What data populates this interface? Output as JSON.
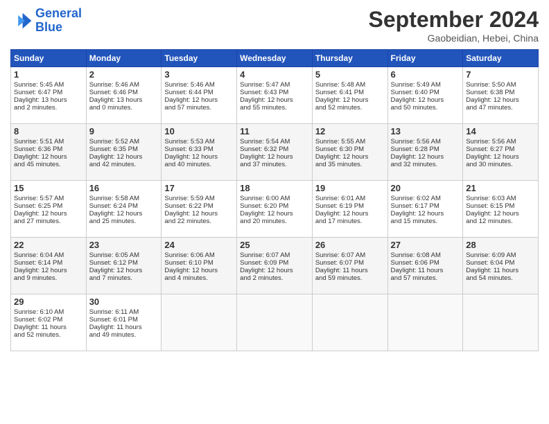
{
  "logo": {
    "line1": "General",
    "line2": "Blue"
  },
  "header": {
    "month": "September 2024",
    "location": "Gaobeidian, Hebei, China"
  },
  "weekdays": [
    "Sunday",
    "Monday",
    "Tuesday",
    "Wednesday",
    "Thursday",
    "Friday",
    "Saturday"
  ],
  "weeks": [
    [
      {
        "day": "1",
        "lines": [
          "Sunrise: 5:45 AM",
          "Sunset: 6:47 PM",
          "Daylight: 13 hours",
          "and 2 minutes."
        ]
      },
      {
        "day": "2",
        "lines": [
          "Sunrise: 5:46 AM",
          "Sunset: 6:46 PM",
          "Daylight: 13 hours",
          "and 0 minutes."
        ]
      },
      {
        "day": "3",
        "lines": [
          "Sunrise: 5:46 AM",
          "Sunset: 6:44 PM",
          "Daylight: 12 hours",
          "and 57 minutes."
        ]
      },
      {
        "day": "4",
        "lines": [
          "Sunrise: 5:47 AM",
          "Sunset: 6:43 PM",
          "Daylight: 12 hours",
          "and 55 minutes."
        ]
      },
      {
        "day": "5",
        "lines": [
          "Sunrise: 5:48 AM",
          "Sunset: 6:41 PM",
          "Daylight: 12 hours",
          "and 52 minutes."
        ]
      },
      {
        "day": "6",
        "lines": [
          "Sunrise: 5:49 AM",
          "Sunset: 6:40 PM",
          "Daylight: 12 hours",
          "and 50 minutes."
        ]
      },
      {
        "day": "7",
        "lines": [
          "Sunrise: 5:50 AM",
          "Sunset: 6:38 PM",
          "Daylight: 12 hours",
          "and 47 minutes."
        ]
      }
    ],
    [
      {
        "day": "8",
        "lines": [
          "Sunrise: 5:51 AM",
          "Sunset: 6:36 PM",
          "Daylight: 12 hours",
          "and 45 minutes."
        ]
      },
      {
        "day": "9",
        "lines": [
          "Sunrise: 5:52 AM",
          "Sunset: 6:35 PM",
          "Daylight: 12 hours",
          "and 42 minutes."
        ]
      },
      {
        "day": "10",
        "lines": [
          "Sunrise: 5:53 AM",
          "Sunset: 6:33 PM",
          "Daylight: 12 hours",
          "and 40 minutes."
        ]
      },
      {
        "day": "11",
        "lines": [
          "Sunrise: 5:54 AM",
          "Sunset: 6:32 PM",
          "Daylight: 12 hours",
          "and 37 minutes."
        ]
      },
      {
        "day": "12",
        "lines": [
          "Sunrise: 5:55 AM",
          "Sunset: 6:30 PM",
          "Daylight: 12 hours",
          "and 35 minutes."
        ]
      },
      {
        "day": "13",
        "lines": [
          "Sunrise: 5:56 AM",
          "Sunset: 6:28 PM",
          "Daylight: 12 hours",
          "and 32 minutes."
        ]
      },
      {
        "day": "14",
        "lines": [
          "Sunrise: 5:56 AM",
          "Sunset: 6:27 PM",
          "Daylight: 12 hours",
          "and 30 minutes."
        ]
      }
    ],
    [
      {
        "day": "15",
        "lines": [
          "Sunrise: 5:57 AM",
          "Sunset: 6:25 PM",
          "Daylight: 12 hours",
          "and 27 minutes."
        ]
      },
      {
        "day": "16",
        "lines": [
          "Sunrise: 5:58 AM",
          "Sunset: 6:24 PM",
          "Daylight: 12 hours",
          "and 25 minutes."
        ]
      },
      {
        "day": "17",
        "lines": [
          "Sunrise: 5:59 AM",
          "Sunset: 6:22 PM",
          "Daylight: 12 hours",
          "and 22 minutes."
        ]
      },
      {
        "day": "18",
        "lines": [
          "Sunrise: 6:00 AM",
          "Sunset: 6:20 PM",
          "Daylight: 12 hours",
          "and 20 minutes."
        ]
      },
      {
        "day": "19",
        "lines": [
          "Sunrise: 6:01 AM",
          "Sunset: 6:19 PM",
          "Daylight: 12 hours",
          "and 17 minutes."
        ]
      },
      {
        "day": "20",
        "lines": [
          "Sunrise: 6:02 AM",
          "Sunset: 6:17 PM",
          "Daylight: 12 hours",
          "and 15 minutes."
        ]
      },
      {
        "day": "21",
        "lines": [
          "Sunrise: 6:03 AM",
          "Sunset: 6:15 PM",
          "Daylight: 12 hours",
          "and 12 minutes."
        ]
      }
    ],
    [
      {
        "day": "22",
        "lines": [
          "Sunrise: 6:04 AM",
          "Sunset: 6:14 PM",
          "Daylight: 12 hours",
          "and 9 minutes."
        ]
      },
      {
        "day": "23",
        "lines": [
          "Sunrise: 6:05 AM",
          "Sunset: 6:12 PM",
          "Daylight: 12 hours",
          "and 7 minutes."
        ]
      },
      {
        "day": "24",
        "lines": [
          "Sunrise: 6:06 AM",
          "Sunset: 6:10 PM",
          "Daylight: 12 hours",
          "and 4 minutes."
        ]
      },
      {
        "day": "25",
        "lines": [
          "Sunrise: 6:07 AM",
          "Sunset: 6:09 PM",
          "Daylight: 12 hours",
          "and 2 minutes."
        ]
      },
      {
        "day": "26",
        "lines": [
          "Sunrise: 6:07 AM",
          "Sunset: 6:07 PM",
          "Daylight: 11 hours",
          "and 59 minutes."
        ]
      },
      {
        "day": "27",
        "lines": [
          "Sunrise: 6:08 AM",
          "Sunset: 6:06 PM",
          "Daylight: 11 hours",
          "and 57 minutes."
        ]
      },
      {
        "day": "28",
        "lines": [
          "Sunrise: 6:09 AM",
          "Sunset: 6:04 PM",
          "Daylight: 11 hours",
          "and 54 minutes."
        ]
      }
    ],
    [
      {
        "day": "29",
        "lines": [
          "Sunrise: 6:10 AM",
          "Sunset: 6:02 PM",
          "Daylight: 11 hours",
          "and 52 minutes."
        ]
      },
      {
        "day": "30",
        "lines": [
          "Sunrise: 6:11 AM",
          "Sunset: 6:01 PM",
          "Daylight: 11 hours",
          "and 49 minutes."
        ]
      },
      {
        "day": "",
        "lines": []
      },
      {
        "day": "",
        "lines": []
      },
      {
        "day": "",
        "lines": []
      },
      {
        "day": "",
        "lines": []
      },
      {
        "day": "",
        "lines": []
      }
    ]
  ]
}
